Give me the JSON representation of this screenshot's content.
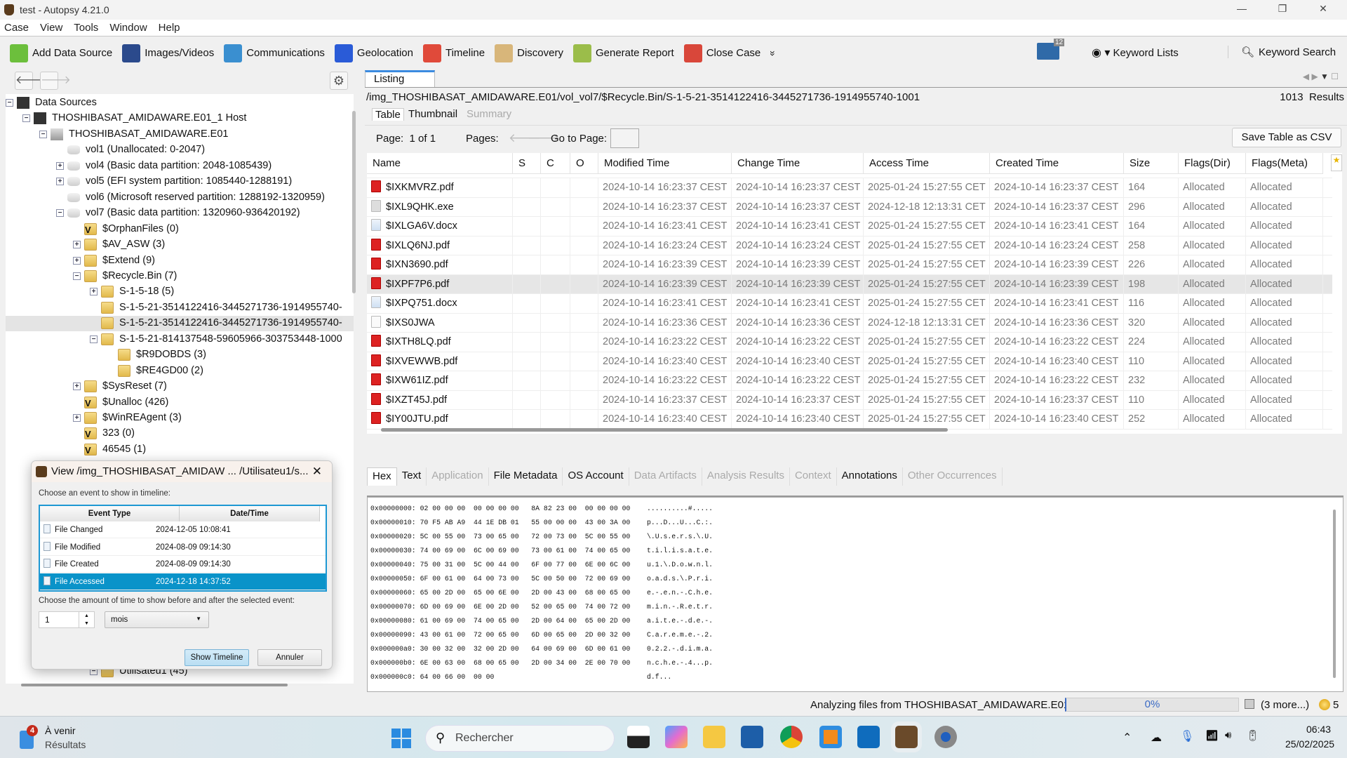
{
  "window": {
    "title": "test - Autopsy 4.21.0",
    "minimize": "—",
    "restore": "❐",
    "close": "✕"
  },
  "menu": [
    "Case",
    "View",
    "Tools",
    "Window",
    "Help"
  ],
  "toolbar": {
    "items": [
      {
        "label": "Add Data Source",
        "icon": "plus",
        "color": "#6cbf3c"
      },
      {
        "label": "Images/Videos",
        "icon": "images",
        "color": "#2b4a8c"
      },
      {
        "label": "Communications",
        "icon": "communications",
        "color": "#3a8fd0"
      },
      {
        "label": "Geolocation",
        "icon": "map-pin",
        "color": "#2a5bd7"
      },
      {
        "label": "Timeline",
        "icon": "timeline",
        "color": "#e04a3a"
      },
      {
        "label": "Discovery",
        "icon": "discovery",
        "color": "#d8b67a"
      },
      {
        "label": "Generate Report",
        "icon": "report",
        "color": "#9bbd4a"
      },
      {
        "label": "Close Case",
        "icon": "close-case",
        "color": "#d9473a"
      }
    ],
    "more": "»",
    "messages_count": "12",
    "keyword_lists": "Keyword Lists",
    "keyword_search": "Keyword Search"
  },
  "tree": {
    "items": [
      {
        "label": "Data Sources",
        "depth": 0,
        "exp": "minus",
        "icon": "datasources"
      },
      {
        "label": "THOSHIBASAT_AMIDAWARE.E01_1 Host",
        "depth": 1,
        "exp": "minus",
        "icon": "host"
      },
      {
        "label": "THOSHIBASAT_AMIDAWARE.E01",
        "depth": 2,
        "exp": "minus",
        "icon": "disk"
      },
      {
        "label": "vol1 (Unallocated: 0-2047)",
        "depth": 3,
        "exp": "",
        "icon": "volume"
      },
      {
        "label": "vol4 (Basic data partition: 2048-1085439)",
        "depth": 3,
        "exp": "plus",
        "icon": "volume"
      },
      {
        "label": "vol5 (EFI system partition: 1085440-1288191)",
        "depth": 3,
        "exp": "plus",
        "icon": "volume"
      },
      {
        "label": "vol6 (Microsoft reserved partition: 1288192-1320959)",
        "depth": 3,
        "exp": "",
        "icon": "volume"
      },
      {
        "label": "vol7 (Basic data partition: 1320960-936420192)",
        "depth": 3,
        "exp": "minus",
        "icon": "volume"
      },
      {
        "label": "$OrphanFiles (0)",
        "depth": 4,
        "exp": "",
        "icon": "virtual-folder"
      },
      {
        "label": "$AV_ASW (3)",
        "depth": 4,
        "exp": "plus",
        "icon": "folder"
      },
      {
        "label": "$Extend (9)",
        "depth": 4,
        "exp": "plus",
        "icon": "folder"
      },
      {
        "label": "$Recycle.Bin (7)",
        "depth": 4,
        "exp": "minus",
        "icon": "folder"
      },
      {
        "label": "S-1-5-18 (5)",
        "depth": 5,
        "exp": "plus",
        "icon": "folder"
      },
      {
        "label": "S-1-5-21-3514122416-3445271736-1914955740-",
        "depth": 5,
        "exp": "",
        "icon": "folder"
      },
      {
        "label": "S-1-5-21-3514122416-3445271736-1914955740-",
        "depth": 5,
        "exp": "",
        "icon": "folder",
        "selected": true
      },
      {
        "label": "S-1-5-21-814137548-59605966-303753448-1000",
        "depth": 5,
        "exp": "minus",
        "icon": "folder"
      },
      {
        "label": "$R9DOBDS (3)",
        "depth": 6,
        "exp": "",
        "icon": "folder"
      },
      {
        "label": "$RE4GD00 (2)",
        "depth": 6,
        "exp": "",
        "icon": "folder"
      },
      {
        "label": "$SysReset (7)",
        "depth": 4,
        "exp": "plus",
        "icon": "folder"
      },
      {
        "label": "$Unalloc (426)",
        "depth": 4,
        "exp": "",
        "icon": "virtual-folder"
      },
      {
        "label": "$WinREAgent (3)",
        "depth": 4,
        "exp": "plus",
        "icon": "folder"
      },
      {
        "label": "323 (0)",
        "depth": 4,
        "exp": "",
        "icon": "virtual-folder"
      },
      {
        "label": "46545 (1)",
        "depth": 4,
        "exp": "",
        "icon": "virtual-folder"
      }
    ],
    "bottom_item": {
      "label": "Utilisateu1 (45)",
      "exp": "minus",
      "icon": "folder"
    }
  },
  "listing": {
    "tab": "Listing",
    "path": "/img_THOSHIBASAT_AMIDAWARE.E01/vol_vol7/$Recycle.Bin/S-1-5-21-3514122416-3445271736-1914955740-1001",
    "results_count": "1013",
    "results_label": "Results",
    "view_tabs": [
      {
        "label": "Table",
        "active": true
      },
      {
        "label": "Thumbnail"
      },
      {
        "label": "Summary",
        "disabled": true
      }
    ],
    "page_label": "Page:",
    "page_value": "1 of 1",
    "pages_label": "Pages:",
    "goto_label": "Go to Page:",
    "goto_value": "",
    "save_csv": "Save Table as CSV",
    "columns": [
      "Name",
      "S",
      "C",
      "O",
      "Modified Time",
      "Change Time",
      "Access Time",
      "Created Time",
      "Size",
      "Flags(Dir)",
      "Flags(Meta)"
    ],
    "rows": [
      {
        "name": "$IXKMVRZ.pdf",
        "type": "pdf",
        "modified": "2024-10-14 16:23:37 CEST",
        "change": "2024-10-14 16:23:37 CEST",
        "access": "2025-01-24 15:27:55 CET",
        "created": "2024-10-14 16:23:37 CEST",
        "size": "164",
        "flags_dir": "Allocated",
        "flags_meta": "Allocated"
      },
      {
        "name": "$IXL9QHK.exe",
        "type": "exe",
        "modified": "2024-10-14 16:23:37 CEST",
        "change": "2024-10-14 16:23:37 CEST",
        "access": "2024-12-18 12:13:31 CET",
        "created": "2024-10-14 16:23:37 CEST",
        "size": "296",
        "flags_dir": "Allocated",
        "flags_meta": "Allocated"
      },
      {
        "name": "$IXLGA6V.docx",
        "type": "docx",
        "modified": "2024-10-14 16:23:41 CEST",
        "change": "2024-10-14 16:23:41 CEST",
        "access": "2025-01-24 15:27:55 CET",
        "created": "2024-10-14 16:23:41 CEST",
        "size": "164",
        "flags_dir": "Allocated",
        "flags_meta": "Allocated"
      },
      {
        "name": "$IXLQ6NJ.pdf",
        "type": "pdf",
        "modified": "2024-10-14 16:23:24 CEST",
        "change": "2024-10-14 16:23:24 CEST",
        "access": "2025-01-24 15:27:55 CET",
        "created": "2024-10-14 16:23:24 CEST",
        "size": "258",
        "flags_dir": "Allocated",
        "flags_meta": "Allocated"
      },
      {
        "name": "$IXN3690.pdf",
        "type": "pdf",
        "modified": "2024-10-14 16:23:39 CEST",
        "change": "2024-10-14 16:23:39 CEST",
        "access": "2025-01-24 15:27:55 CET",
        "created": "2024-10-14 16:23:39 CEST",
        "size": "226",
        "flags_dir": "Allocated",
        "flags_meta": "Allocated"
      },
      {
        "name": "$IXPF7P6.pdf",
        "type": "pdf",
        "selected": true,
        "modified": "2024-10-14 16:23:39 CEST",
        "change": "2024-10-14 16:23:39 CEST",
        "access": "2025-01-24 15:27:55 CET",
        "created": "2024-10-14 16:23:39 CEST",
        "size": "198",
        "flags_dir": "Allocated",
        "flags_meta": "Allocated"
      },
      {
        "name": "$IXPQ751.docx",
        "type": "docx",
        "modified": "2024-10-14 16:23:41 CEST",
        "change": "2024-10-14 16:23:41 CEST",
        "access": "2025-01-24 15:27:55 CET",
        "created": "2024-10-14 16:23:41 CEST",
        "size": "116",
        "flags_dir": "Allocated",
        "flags_meta": "Allocated"
      },
      {
        "name": "$IXS0JWA",
        "type": "blank",
        "modified": "2024-10-14 16:23:36 CEST",
        "change": "2024-10-14 16:23:36 CEST",
        "access": "2024-12-18 12:13:31 CET",
        "created": "2024-10-14 16:23:36 CEST",
        "size": "320",
        "flags_dir": "Allocated",
        "flags_meta": "Allocated"
      },
      {
        "name": "$IXTH8LQ.pdf",
        "type": "pdf",
        "modified": "2024-10-14 16:23:22 CEST",
        "change": "2024-10-14 16:23:22 CEST",
        "access": "2025-01-24 15:27:55 CET",
        "created": "2024-10-14 16:23:22 CEST",
        "size": "224",
        "flags_dir": "Allocated",
        "flags_meta": "Allocated"
      },
      {
        "name": "$IXVEWWB.pdf",
        "type": "pdf",
        "modified": "2024-10-14 16:23:40 CEST",
        "change": "2024-10-14 16:23:40 CEST",
        "access": "2025-01-24 15:27:55 CET",
        "created": "2024-10-14 16:23:40 CEST",
        "size": "110",
        "flags_dir": "Allocated",
        "flags_meta": "Allocated"
      },
      {
        "name": "$IXW61IZ.pdf",
        "type": "pdf",
        "modified": "2024-10-14 16:23:22 CEST",
        "change": "2024-10-14 16:23:22 CEST",
        "access": "2025-01-24 15:27:55 CET",
        "created": "2024-10-14 16:23:22 CEST",
        "size": "232",
        "flags_dir": "Allocated",
        "flags_meta": "Allocated"
      },
      {
        "name": "$IXZT45J.pdf",
        "type": "pdf",
        "modified": "2024-10-14 16:23:37 CEST",
        "change": "2024-10-14 16:23:37 CEST",
        "access": "2025-01-24 15:27:55 CET",
        "created": "2024-10-14 16:23:37 CEST",
        "size": "110",
        "flags_dir": "Allocated",
        "flags_meta": "Allocated"
      },
      {
        "name": "$IY00JTU.pdf",
        "type": "pdf",
        "modified": "2024-10-14 16:23:40 CEST",
        "change": "2024-10-14 16:23:40 CEST",
        "access": "2025-01-24 15:27:55 CET",
        "created": "2024-10-14 16:23:40 CEST",
        "size": "252",
        "flags_dir": "Allocated",
        "flags_meta": "Allocated"
      }
    ]
  },
  "viewer": {
    "tabs": [
      {
        "label": "Hex",
        "active": true
      },
      {
        "label": "Text"
      },
      {
        "label": "Application",
        "disabled": true
      },
      {
        "label": "File Metadata"
      },
      {
        "label": "OS Account"
      },
      {
        "label": "Data Artifacts",
        "disabled": true
      },
      {
        "label": "Analysis Results",
        "disabled": true
      },
      {
        "label": "Context",
        "disabled": true
      },
      {
        "label": "Annotations"
      },
      {
        "label": "Other Occurrences",
        "disabled": true
      }
    ],
    "hex": [
      [
        "0x00000000:",
        "02 00 00 00  00 00 00 00   8A 82 23 00  00 00 00 00",
        "..........#....."
      ],
      [
        "0x00000010:",
        "70 F5 AB A9  44 1E DB 01   55 00 00 00  43 00 3A 00",
        "p...D...U...C.:."
      ],
      [
        "0x00000020:",
        "5C 00 55 00  73 00 65 00   72 00 73 00  5C 00 55 00",
        "\\.U.s.e.r.s.\\.U."
      ],
      [
        "0x00000030:",
        "74 00 69 00  6C 00 69 00   73 00 61 00  74 00 65 00",
        "t.i.l.i.s.a.t.e."
      ],
      [
        "0x00000040:",
        "75 00 31 00  5C 00 44 00   6F 00 77 00  6E 00 6C 00",
        "u.1.\\.D.o.w.n.l."
      ],
      [
        "0x00000050:",
        "6F 00 61 00  64 00 73 00   5C 00 50 00  72 00 69 00",
        "o.a.d.s.\\.P.r.i."
      ],
      [
        "0x00000060:",
        "65 00 2D 00  65 00 6E 00   2D 00 43 00  68 00 65 00",
        "e.-.e.n.-.C.h.e."
      ],
      [
        "0x00000070:",
        "6D 00 69 00  6E 00 2D 00   52 00 65 00  74 00 72 00",
        "m.i.n.-.R.e.t.r."
      ],
      [
        "0x00000080:",
        "61 00 69 00  74 00 65 00   2D 00 64 00  65 00 2D 00",
        "a.i.t.e.-.d.e.-."
      ],
      [
        "0x00000090:",
        "43 00 61 00  72 00 65 00   6D 00 65 00  2D 00 32 00",
        "C.a.r.e.m.e.-.2."
      ],
      [
        "0x000000a0:",
        "30 00 32 00  32 00 2D 00   64 00 69 00  6D 00 61 00",
        "0.2.2.-.d.i.m.a."
      ],
      [
        "0x000000b0:",
        "6E 00 63 00  68 00 65 00   2D 00 34 00  2E 00 70 00",
        "n.c.h.e.-.4...p."
      ],
      [
        "0x000000c0:",
        "64 00 66 00  00 00                                 ",
        "d.f..."
      ]
    ]
  },
  "dialog": {
    "title": "View /img_THOSHIBASAT_AMIDAW ... /Utilisateu1/s...",
    "choose_event": "Choose an event to show in timeline:",
    "columns": [
      "Event Type",
      "Date/Time"
    ],
    "events": [
      {
        "type": "File Changed",
        "letter": "C",
        "datetime": "2024-12-05 10:08:41"
      },
      {
        "type": "File Modified",
        "letter": "M",
        "datetime": "2024-08-09 09:14:30"
      },
      {
        "type": "File Created",
        "letter": "B",
        "datetime": "2024-08-09 09:14:30"
      },
      {
        "type": "File Accessed",
        "letter": "A",
        "datetime": "2024-12-18 14:37:52",
        "selected": true
      }
    ],
    "choose_amount": "Choose the amount of time to show before and after the selected event:",
    "amount_value": "1",
    "unit_value": "mois",
    "show_timeline": "Show Timeline",
    "cancel": "Annuler"
  },
  "status": {
    "text": "Analyzing files from THOSHIBASAT_AMIDAWARE.E01",
    "progress": "0%",
    "progress_value": 0,
    "more": "(3 more...)",
    "notifications": "5"
  },
  "taskbar": {
    "widget_badge": "4",
    "widget_title": "À venir",
    "widget_sub": "Résultats",
    "search_placeholder": "Rechercher",
    "time": "06:43",
    "date": "25/02/2025"
  }
}
